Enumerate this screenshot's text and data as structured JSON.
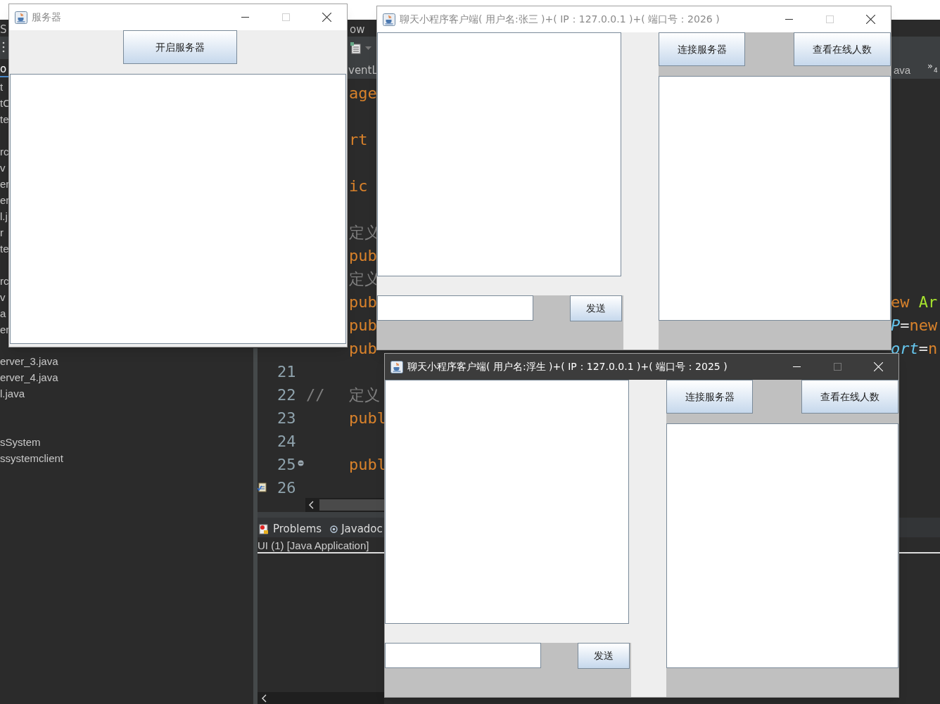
{
  "ide": {
    "menu": [
      "S",
      "ow"
    ],
    "left_tab": "o",
    "tree": [
      "t",
      "tC",
      "te",
      "rc",
      "v",
      "er",
      "er",
      "l.j",
      "r",
      "te",
      "rc",
      "v",
      "a",
      "er",
      "erver_3.java",
      "erver_4.java",
      "l.java",
      "sSystem",
      "ssystemclient"
    ],
    "editor_tabs": [
      "ventL",
      "ava"
    ],
    "overflow": {
      "chevron": "»",
      "count": "4"
    },
    "code_lines": [
      {
        "segments": [
          {
            "text": "age",
            "kind": "keyword"
          }
        ]
      },
      {
        "segments": [
          {
            "text": "rt",
            "kind": "keyword"
          }
        ]
      },
      {
        "segments": [
          {
            "text": "ic",
            "kind": "keyword"
          }
        ]
      },
      {
        "segments": [
          {
            "text": "定义",
            "kind": "comment"
          }
        ]
      },
      {
        "segments": [
          {
            "text": "pub",
            "kind": "keyword"
          }
        ]
      },
      {
        "segments": [
          {
            "text": "定义",
            "kind": "comment"
          }
        ]
      },
      {
        "segments": [
          {
            "text": "pub",
            "kind": "keyword"
          }
        ],
        "tail": [
          {
            "text": "ew ",
            "kind": "keyword"
          },
          {
            "text": "Ar",
            "kind": "type"
          }
        ]
      },
      {
        "segments": [
          {
            "text": "pub",
            "kind": "keyword"
          }
        ],
        "tail": [
          {
            "text": "P",
            "kind": "field"
          },
          {
            "text": "=",
            "kind": "plain"
          },
          {
            "text": "new",
            "kind": "keyword"
          }
        ]
      },
      {
        "segments": [
          {
            "text": "pub",
            "kind": "keyword"
          }
        ],
        "tail": [
          {
            "text": "ort",
            "kind": "field"
          },
          {
            "text": "=",
            "kind": "plain"
          },
          {
            "text": "n",
            "kind": "keyword"
          }
        ]
      },
      {
        "number": "21"
      },
      {
        "number": "22",
        "prefix": "//",
        "segments": [
          {
            "text": "定义",
            "kind": "comment"
          }
        ]
      },
      {
        "number": "23",
        "segments": [
          {
            "text": "publ",
            "kind": "keyword"
          }
        ]
      },
      {
        "number": "24"
      },
      {
        "number": "25",
        "folded": true,
        "segments": [
          {
            "text": "publ",
            "kind": "keyword"
          }
        ]
      },
      {
        "number": "26",
        "task": true
      }
    ],
    "views": [
      {
        "label": "Problems",
        "kind": "problems"
      },
      {
        "label": "Javadoc",
        "kind": "javadoc"
      }
    ],
    "console": "UI (1) [Java Application]"
  },
  "windows": [
    {
      "kind": "server",
      "title": "服务器",
      "active": false,
      "button": "开启服务器"
    },
    {
      "kind": "client",
      "title": "聊天小程序客户端( 用户名:张三 )+( IP：127.0.0.1 )+( 端口号：2026 )",
      "active": false,
      "connect": "连接服务器",
      "online": "查看在线人数",
      "send": "发送"
    },
    {
      "kind": "client",
      "title": "聊天小程序客户端( 用户名:浮生 )+( IP：127.0.0.1 )+( 端口号：2025 )",
      "active": true,
      "connect": "连接服务器",
      "online": "查看在线人数",
      "send": "发送"
    }
  ]
}
